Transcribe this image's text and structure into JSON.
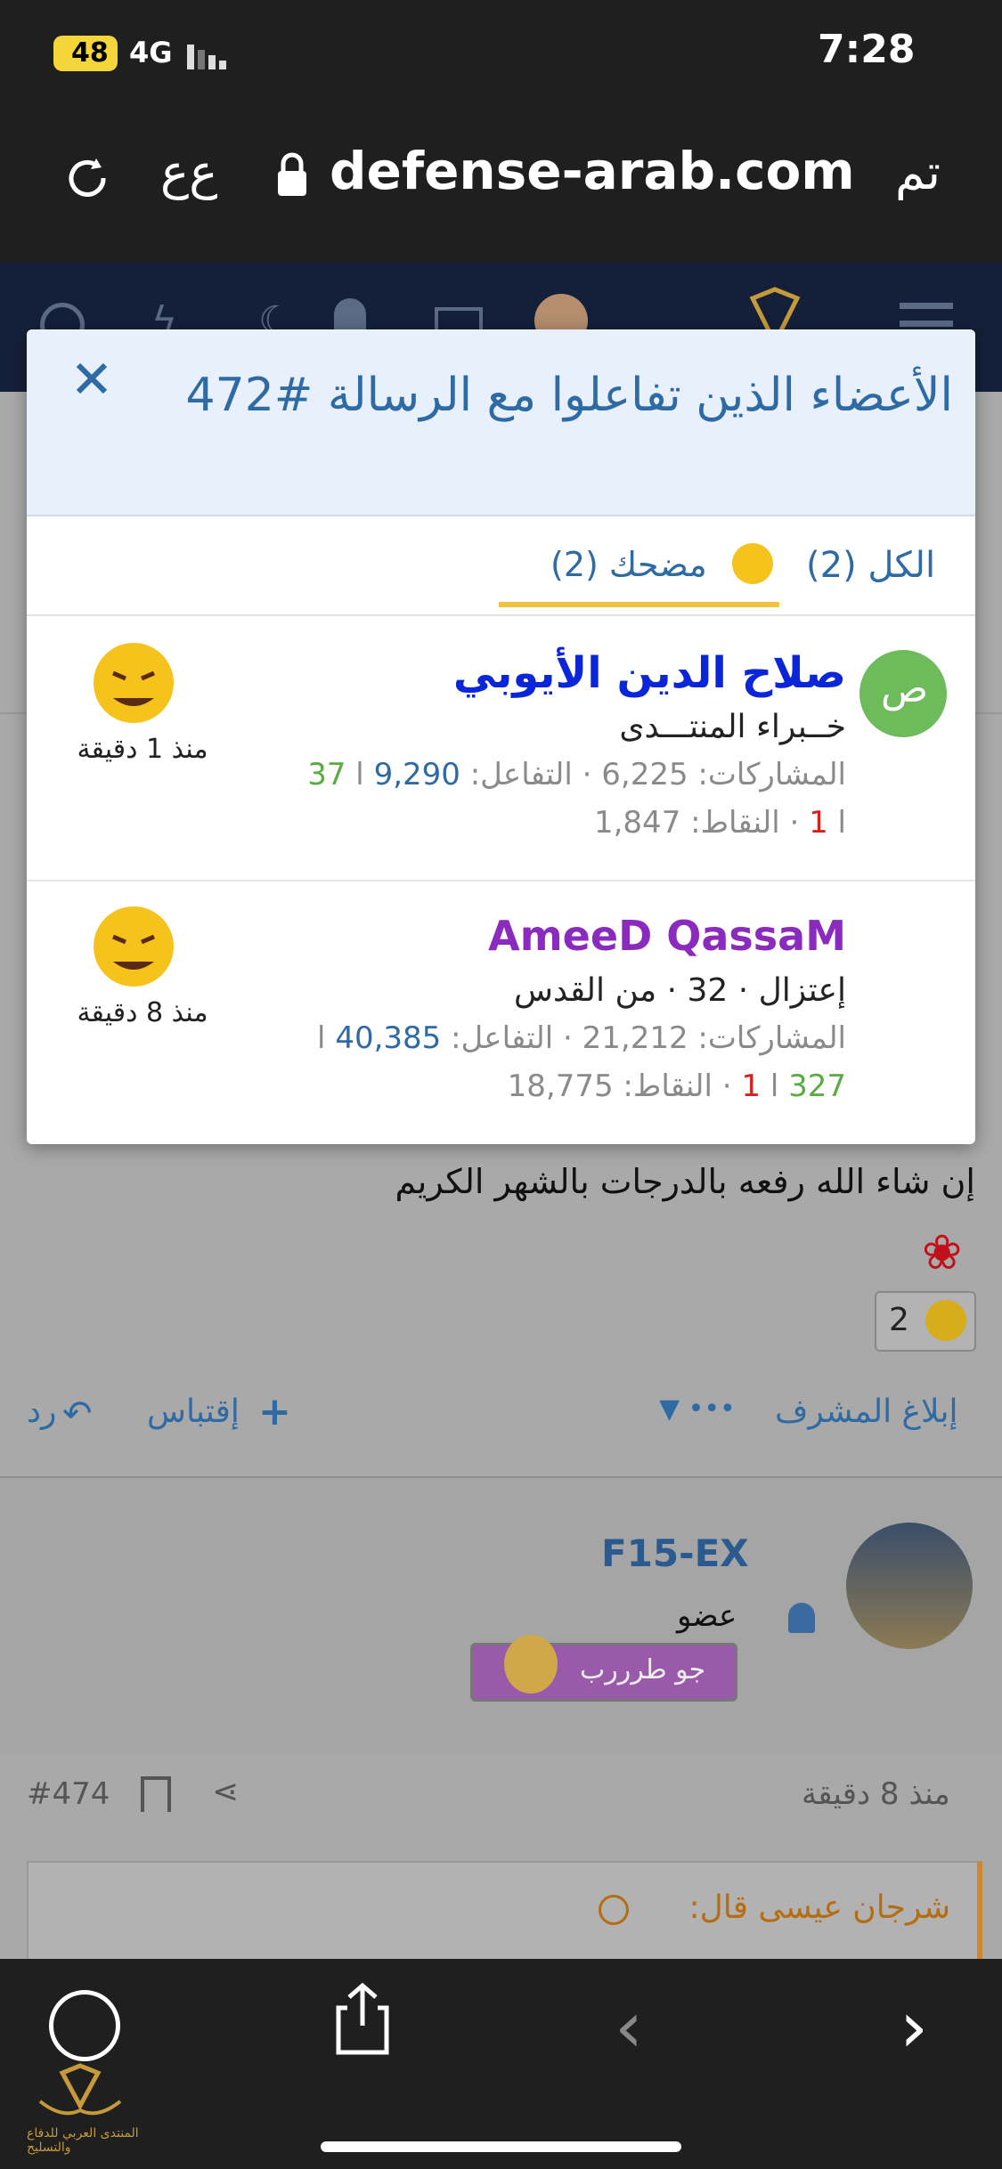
{
  "status": {
    "time": "7:28",
    "battery": "48",
    "network": "4G"
  },
  "browser": {
    "done_label": "تم",
    "aa_label": "ع‌ع",
    "url": "defense-arab.com"
  },
  "modal": {
    "title": "الأعضاء الذين تفاعلوا مع الرسالة #472",
    "tabs": [
      {
        "label": "الكل (2)"
      },
      {
        "label": "مضحك (2)"
      }
    ],
    "rows": [
      {
        "avatar_letter": "ص",
        "name": "صلاح الدين الأيوبي",
        "subtitle": "خــبراء المنتـــدى",
        "stats_line1_prefix": "المشاركات: 6,225 · التفاعل:",
        "stats_line1_value": "9,290",
        "stats_line1_sep": "ا",
        "stats_line1_green": "37",
        "stats_line2_sep": "ا",
        "stats_line2_red": "1",
        "stats_line2_suffix": "· النقاط: 1,847",
        "time": "منذ 1 دقيقة"
      },
      {
        "name": "AmeeD QassaM",
        "subtitle": "إعتزال · 32 · من القدس",
        "stats_line1_prefix": "المشاركات: 21,212 · التفاعل:",
        "stats_line1_value": "40,385",
        "stats_line1_sep": "ا",
        "stats_line2_green": "327",
        "stats_line2_sep": "ا",
        "stats_line2_red": "1",
        "stats_line2_suffix": "· النقاط: 18,775",
        "time": "منذ 8 دقيقة"
      }
    ]
  },
  "post": {
    "text": "إن شاء الله رفعه بالدرجات بالشهر الكريم",
    "reaction_count": "2",
    "report_label": "إبلاغ المشرف",
    "more_label": "•••",
    "quote_label": "إقتباس",
    "reply_label": "رد"
  },
  "post2": {
    "username": "F15-EX",
    "role": "عضو",
    "badge_text": "جو طرررب",
    "time": "منذ 8 دقيقة",
    "post_number": "#474",
    "quote_author": "شرجان عيسى قال:"
  },
  "watermark": "المنتدى العربي للدفاع والتسليح"
}
